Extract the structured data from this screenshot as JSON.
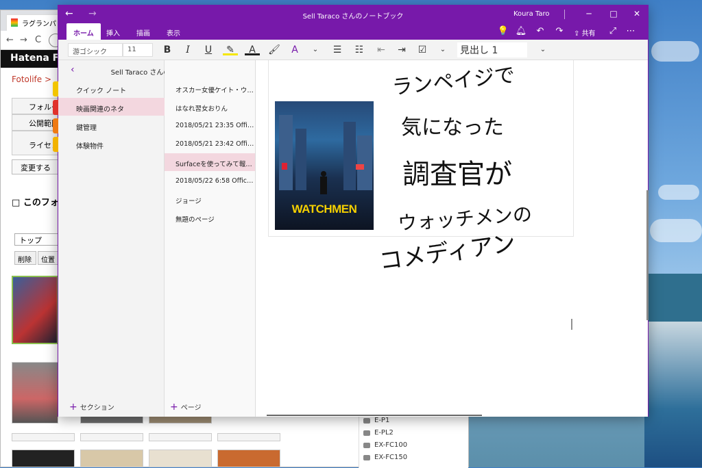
{
  "browser": {
    "tab_title": "ラグランパンチ",
    "site_logo": "Hatena Fo",
    "breadcrumb": "Fotolife > ",
    "form_rows": [
      "フォルダ",
      "公開範囲",
      "ライセン"
    ],
    "change_button": "変更する",
    "folder_heading": "このフォル",
    "select_value": "トップ",
    "delete_button": "削除",
    "move_button": "位置",
    "side_list": [
      "E-P1",
      "E-PL2",
      "EX-FC100",
      "EX-FC150"
    ]
  },
  "window": {
    "title": "Sell Taraco さんのノートブック",
    "user": "Koura Taro"
  },
  "ribbon": {
    "tabs": [
      "ホーム",
      "挿入",
      "描画",
      "表示"
    ],
    "share_label": "共有",
    "font_name": "游ゴシック",
    "font_size": "11",
    "style_name": "見出し 1"
  },
  "notebook": {
    "title": "Sell Taraco さんのノートブック",
    "sections": [
      {
        "label": "クイック ノート",
        "color": "#f2c500"
      },
      {
        "label": "映画関連のネタ",
        "color": "#e0312b"
      },
      {
        "label": "鍵管理",
        "color": "#ef7a12"
      },
      {
        "label": "体験物件",
        "color": "#f2b300"
      }
    ],
    "pages": [
      "オスカー女優ケイト・ウィン…",
      "はなれ習女おりん",
      "2018/05/21 23:35 Offic…",
      "2018/05/21 23:42 Offic…",
      "Surfaceを使ってみて報告…",
      "2018/05/22 6:58 Office…",
      "ジョージ",
      "無題のページ"
    ],
    "add_section": "セクション",
    "add_page": "ページ"
  },
  "note": {
    "poster_title": "WATCHMEN",
    "handwriting": [
      "ランペイジで",
      "気になった",
      "調査官が",
      "ウォッチメンの",
      "コメディアン"
    ]
  }
}
